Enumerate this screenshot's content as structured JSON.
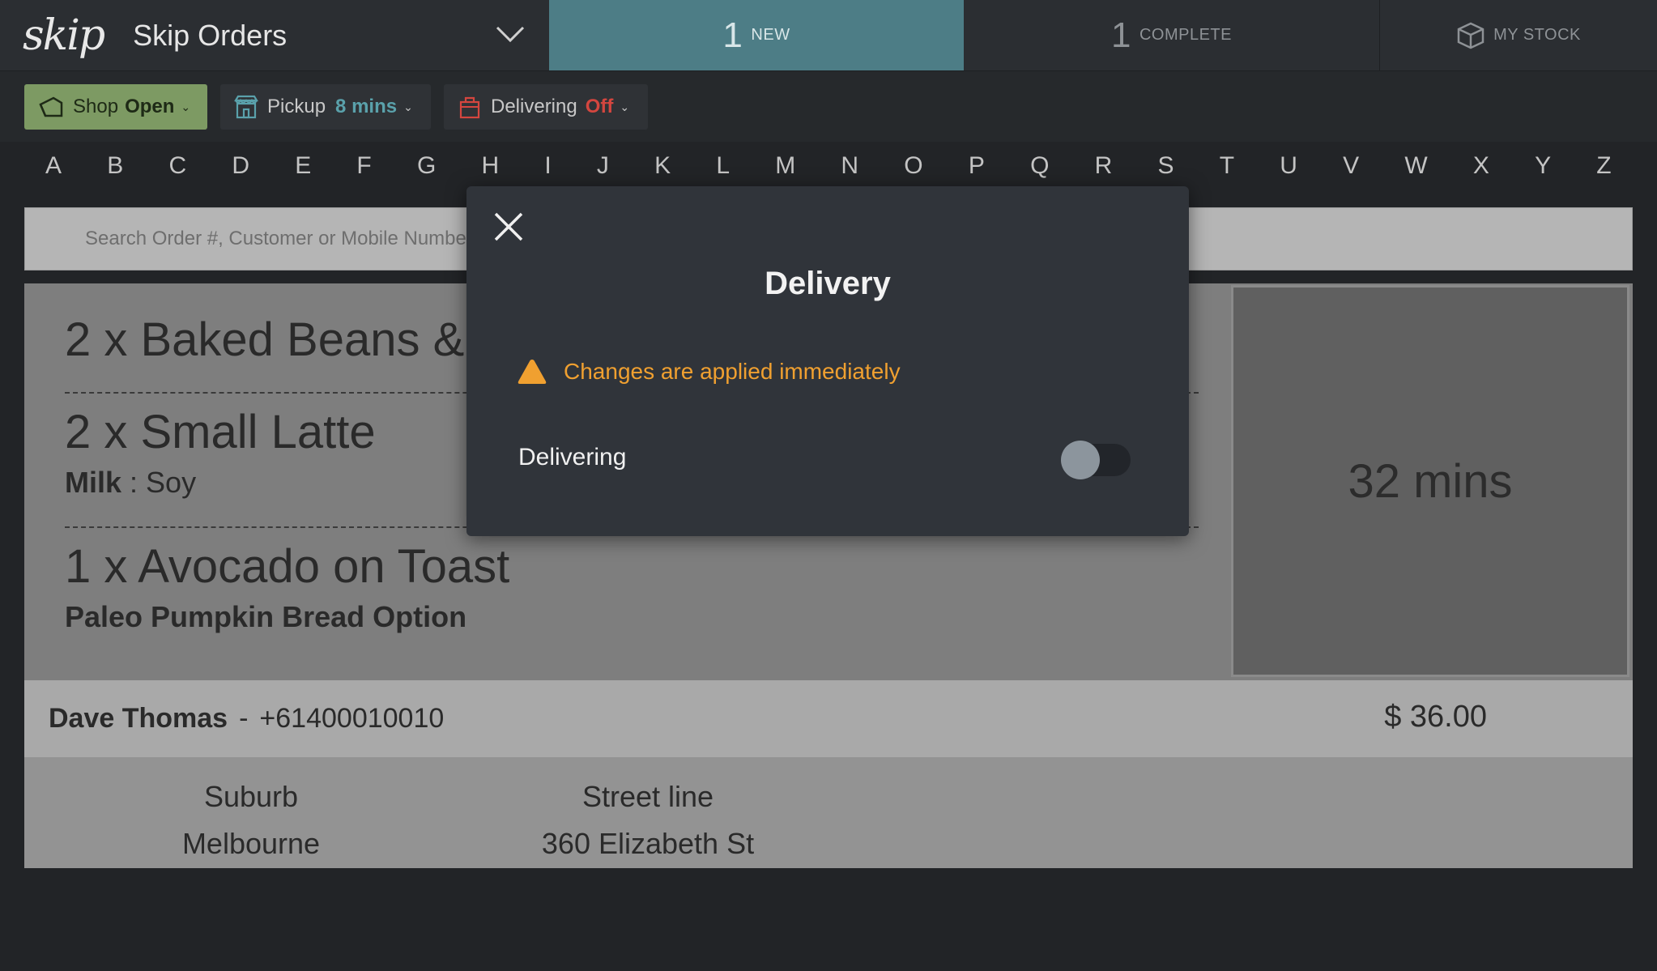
{
  "header": {
    "logo": "skip",
    "app_title": "Skip Orders",
    "tabs": {
      "new": {
        "count": "1",
        "label": "NEW"
      },
      "complete": {
        "count": "1",
        "label": "COMPLETE"
      },
      "stock": {
        "label": "MY STOCK"
      }
    }
  },
  "status": {
    "shop": {
      "label": "Shop",
      "value": "Open"
    },
    "pickup": {
      "label": "Pickup",
      "value": "8 mins"
    },
    "delivering": {
      "label": "Delivering",
      "value": "Off"
    }
  },
  "alphabet": [
    "A",
    "B",
    "C",
    "D",
    "E",
    "F",
    "G",
    "H",
    "I",
    "J",
    "K",
    "L",
    "M",
    "N",
    "O",
    "P",
    "Q",
    "R",
    "S",
    "T",
    "U",
    "V",
    "W",
    "X",
    "Y",
    "Z"
  ],
  "search": {
    "placeholder": "Search Order #, Customer or Mobile Number"
  },
  "order": {
    "items": [
      {
        "text": "2 x Baked Beans &"
      },
      {
        "text": "2 x Small Latte",
        "option_name": "Milk",
        "option_sep": " : ",
        "option_value": "Soy"
      },
      {
        "text": "1 x Avocado on Toast",
        "option": "Paleo Pumpkin Bread Option"
      }
    ],
    "timer": "32 mins",
    "customer": {
      "name": "Dave Thomas",
      "dash": "-",
      "phone": "+61400010010"
    },
    "price": "$ 36.00",
    "address": {
      "suburb_label": "Suburb",
      "suburb": "Melbourne",
      "street_label": "Street line",
      "street": "360 Elizabeth St"
    }
  },
  "modal": {
    "title": "Delivery",
    "warning": "Changes are applied immediately",
    "toggle_label": "Delivering",
    "toggle_on": false
  },
  "colors": {
    "accent_teal": "#4d7d86",
    "shop_open": "#7d9a63",
    "pickup_value": "#5aa1ab",
    "delivering_off": "#d4463f",
    "warning": "#f0a030"
  }
}
